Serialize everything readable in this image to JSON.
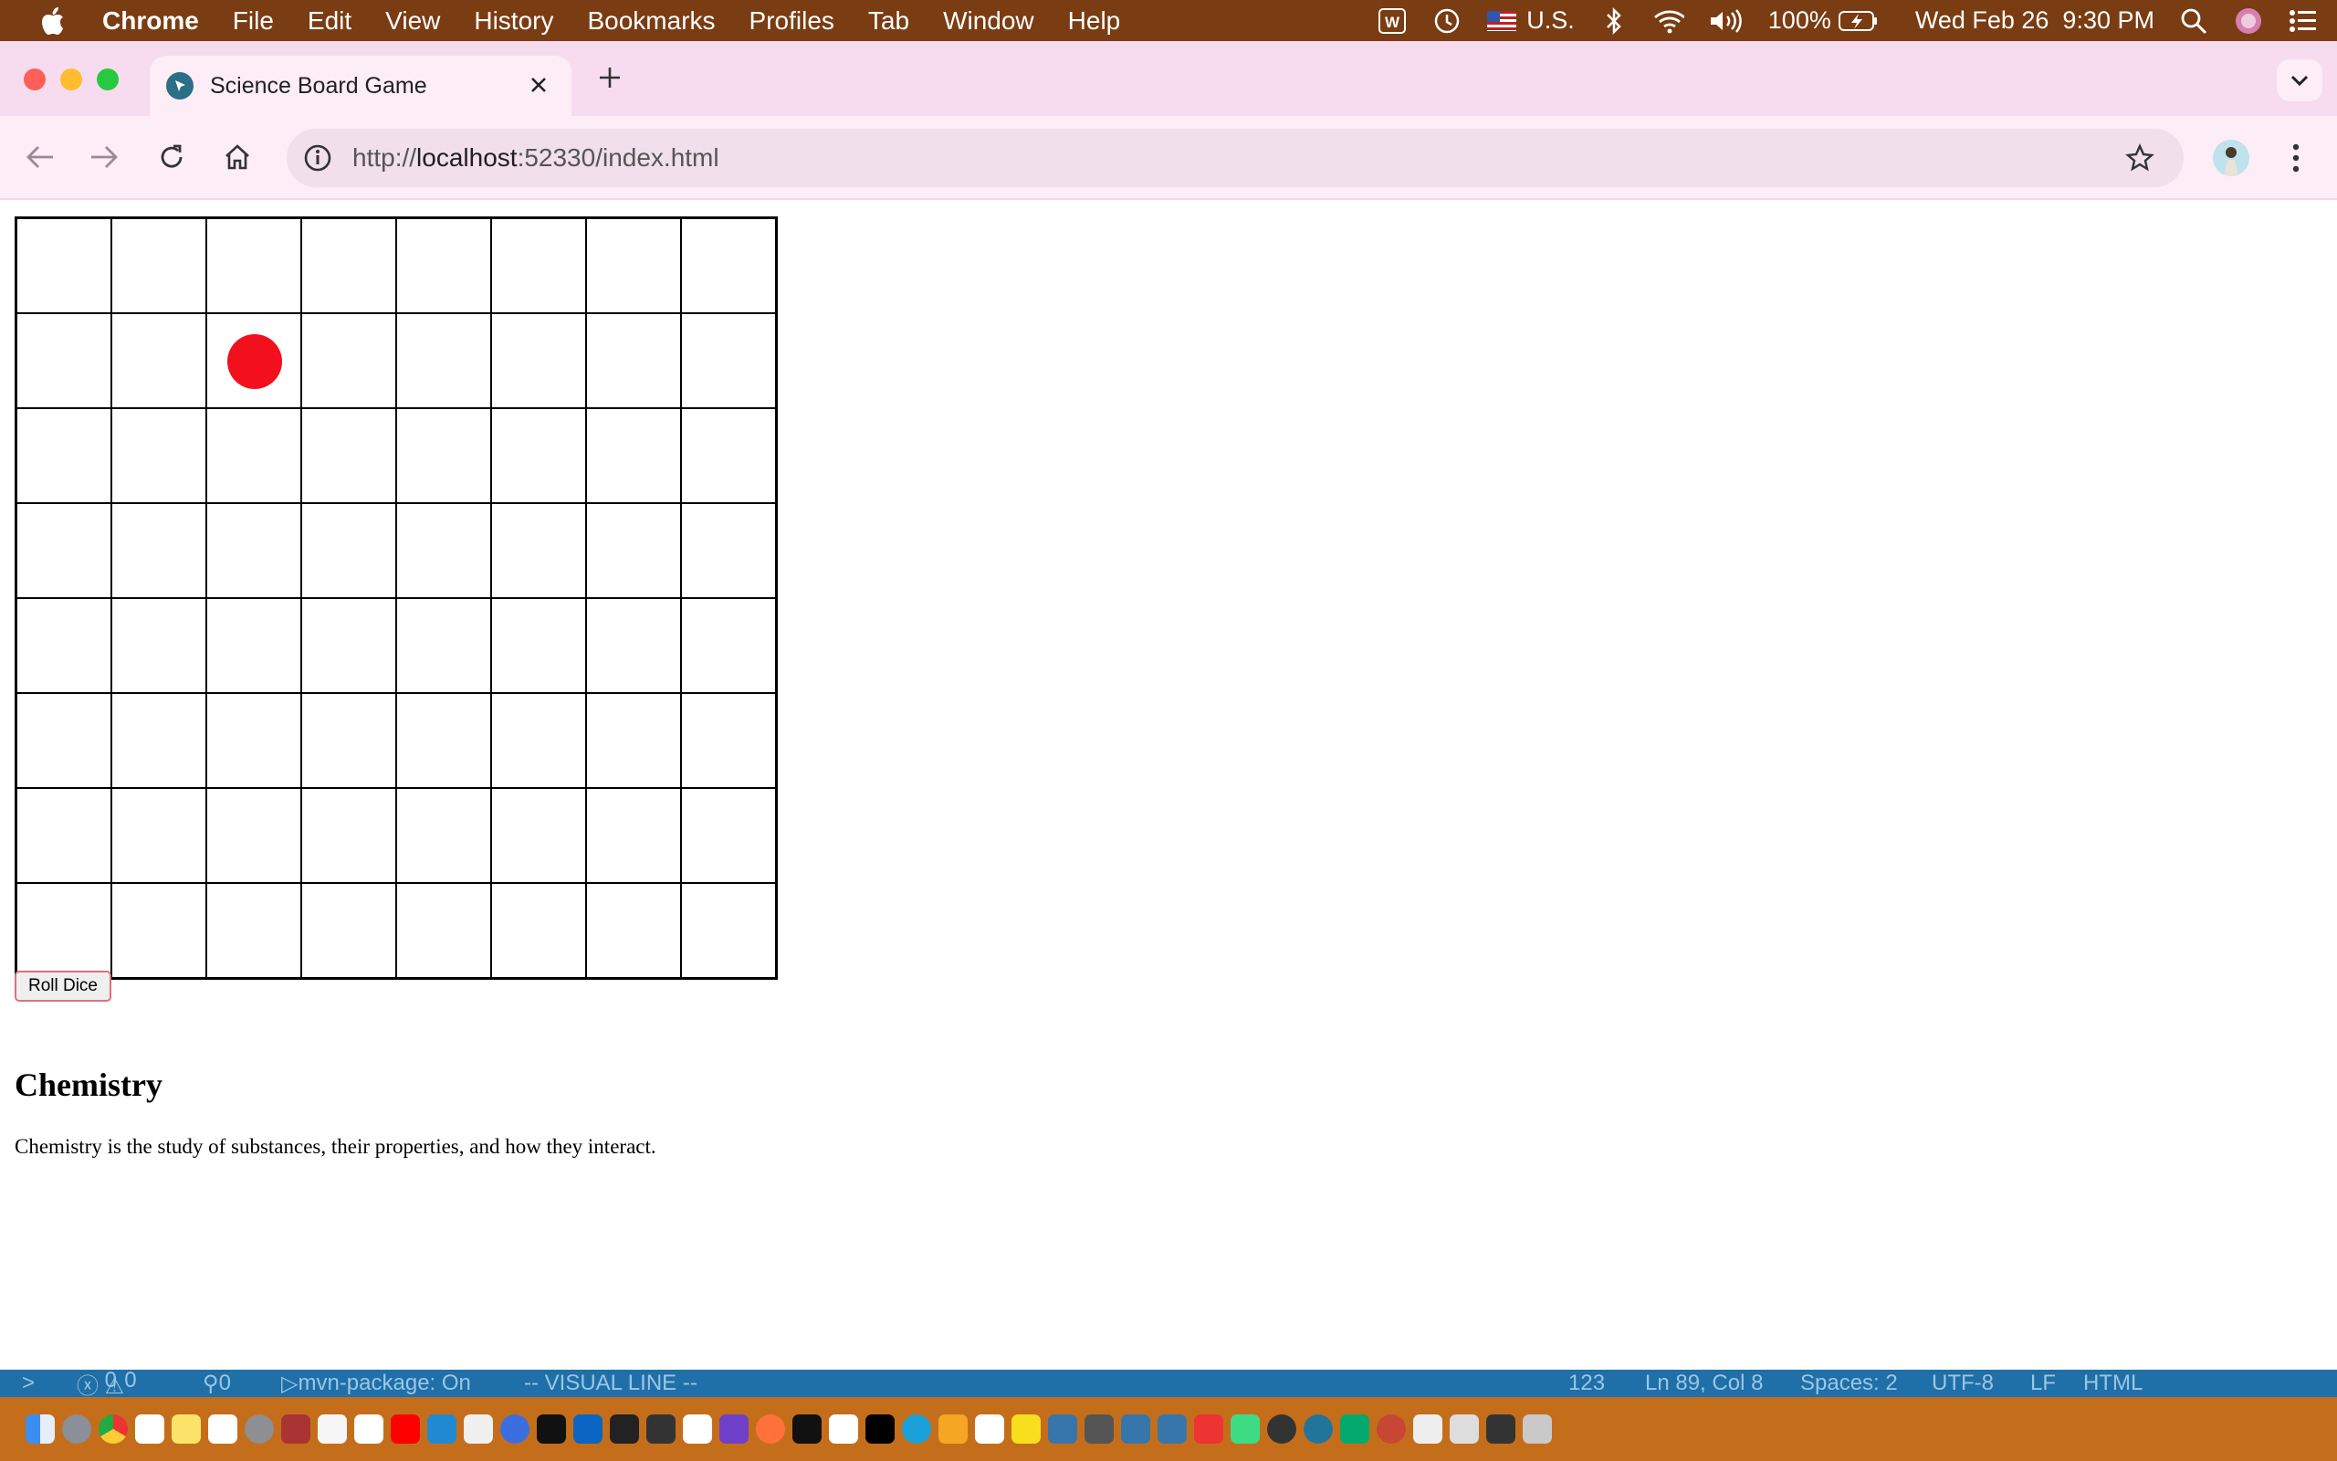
{
  "menubar": {
    "app_name": "Chrome",
    "items": [
      "File",
      "Edit",
      "View",
      "History",
      "Bookmarks",
      "Profiles",
      "Tab",
      "Window",
      "Help"
    ],
    "input_source": "U.S.",
    "battery": "100%",
    "datetime": "Wed Feb 26  9:30 PM"
  },
  "browser": {
    "tab_title": "Science Board Game",
    "url_prefix": "http://",
    "url_host": "localhost",
    "url_rest": ":52330/index.html"
  },
  "game": {
    "board_size": 8,
    "token": {
      "row": 2,
      "col": 3,
      "color": "#f2101f"
    },
    "roll_button_label": "Roll Dice",
    "topic_title": "Chemistry",
    "topic_description": "Chemistry is the study of substances, their properties, and how they interact."
  },
  "statusbar": {
    "problems": "0",
    "warnings": "0",
    "ports": "0",
    "task": "mvn-package: On",
    "mode": "-- VISUAL LINE --",
    "selection": "123",
    "cursor": "Ln 89, Col 8",
    "indent": "Spaces: 2",
    "encoding": "UTF-8",
    "eol": "LF",
    "language": "HTML"
  },
  "colors": {
    "menubar_bg": "#7a3c12",
    "tabstrip_bg": "#f7dcef",
    "toolbar_bg": "#fcedf7",
    "token_red": "#f2101f",
    "roll_button_border": "#e0707d"
  }
}
